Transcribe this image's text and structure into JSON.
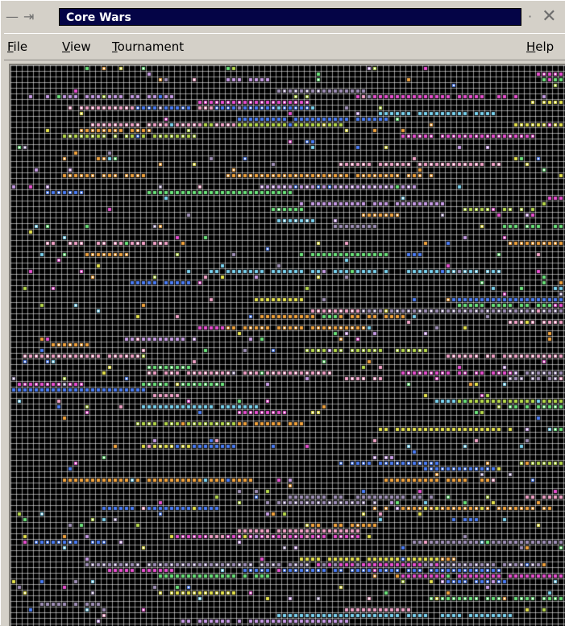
{
  "window": {
    "title": "Core Wars",
    "controls_left": [
      "menu-dash-icon",
      "pin-icon"
    ],
    "controls_right": [
      "minimize-dot-icon",
      "close-x-icon"
    ]
  },
  "menubar": {
    "items": [
      {
        "label_ul": "F",
        "label_rest": "ile"
      },
      {
        "label_ul": "V",
        "label_rest": "iew"
      },
      {
        "label_ul": "T",
        "label_rest": "ournament"
      },
      {
        "label_ul": "H",
        "label_rest": "elp"
      }
    ]
  },
  "core": {
    "cell_pitch": 7,
    "colors": {
      "background": "#000000",
      "grid": "#ffffff",
      "warriors": [
        "#7ad3f0",
        "#f3a2c8",
        "#e6e34b",
        "#c79be6",
        "#6ae27a",
        "#f2a33c",
        "#4a7cf5",
        "#e84fd0",
        "#b6d94a",
        "#9f8fb7"
      ]
    }
  }
}
